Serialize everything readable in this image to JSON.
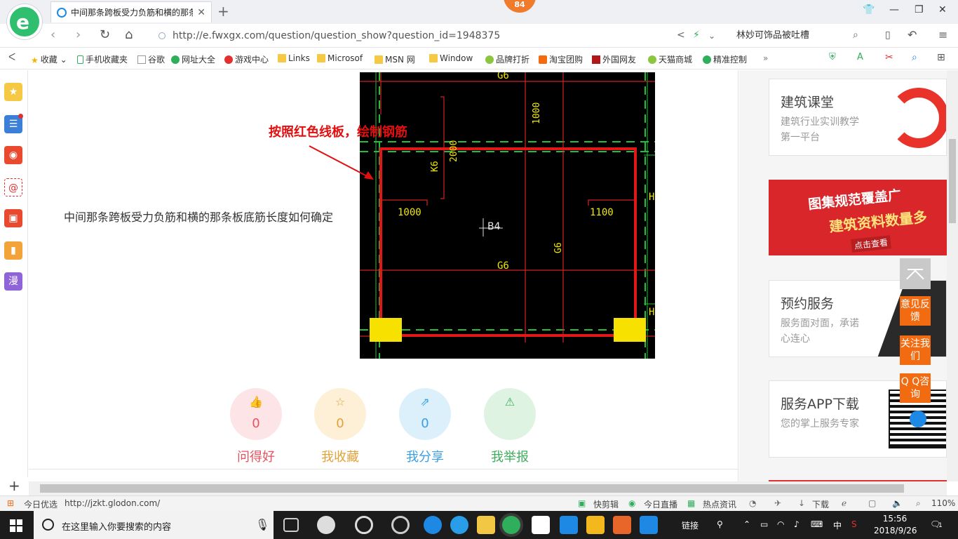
{
  "browser": {
    "tab_title": "中间那条跨板受力负筋和横的那条",
    "new_tab": "+",
    "notification_count": "84",
    "url": "http://e.fwxgx.com/question/question_show?question_id=1948375",
    "search_value": "林妙可饰品被吐槽"
  },
  "bookmarks": [
    {
      "label": "收藏"
    },
    {
      "label": "手机收藏夹"
    },
    {
      "label": "谷歌"
    },
    {
      "label": "网址大全"
    },
    {
      "label": "游戏中心"
    },
    {
      "label": "Links"
    },
    {
      "label": "Microsof"
    },
    {
      "label": "MSN 网"
    },
    {
      "label": "Window"
    },
    {
      "label": "品牌打折"
    },
    {
      "label": "淘宝团购"
    },
    {
      "label": "外国网友"
    },
    {
      "label": "天猫商城"
    },
    {
      "label": "精准控制"
    }
  ],
  "sidebar": {
    "manga_label": "漫"
  },
  "question": {
    "text": "中间那条跨板受力负筋和横的那条板底筋长度如何确定",
    "annotation": "按照红色线板，绘制钢筋"
  },
  "cad_labels": {
    "g6_top": "G6",
    "k6": "K6",
    "dim_2000": "2000",
    "dim_1000_v": "1000",
    "dim_1000_h": "1000",
    "dim_1100": "1100",
    "b4": "B4",
    "g6_mid": "G6",
    "g6_vert": "G6",
    "h1": "H",
    "h2": "H"
  },
  "actions": [
    {
      "label": "问得好",
      "count": "0",
      "color": "#e8525e",
      "bg": "#fde4e6",
      "icon": "thumbs-up-icon"
    },
    {
      "label": "我收藏",
      "count": "0",
      "color": "#e2a23a",
      "bg": "#fdf0d6",
      "icon": "star-icon"
    },
    {
      "label": "我分享",
      "count": "0",
      "color": "#3b9ee0",
      "bg": "#dcf0fc",
      "icon": "share-icon"
    },
    {
      "label": "我举报",
      "count": "0",
      "color": "#3fae5c",
      "bg": "#dff3e3",
      "icon": "warning-icon"
    }
  ],
  "right": {
    "card1": {
      "title": "建筑课堂",
      "sub": "建筑行业实训教学第一平台"
    },
    "promo": {
      "line1": "图集规范覆盖广",
      "line2": "建筑资料数量多",
      "cta": "点击查看"
    },
    "card2": {
      "title": "预约服务",
      "sub": "服务面对面，承诺心连心"
    },
    "card3": {
      "title": "服务APP下载",
      "sub": "您的掌上服务专家"
    }
  },
  "floating": {
    "feedback": "意见反馈",
    "follow": "关注我们",
    "qq": "Q Q咨询"
  },
  "statusbar": {
    "today": "今日优选",
    "link": "http://jzkt.glodon.com/",
    "clip": "快剪辑",
    "live": "今日直播",
    "news": "热点资讯",
    "download": "下载",
    "zoom": "110%"
  },
  "taskbar": {
    "search_placeholder": "在这里输入你要搜索的内容",
    "links": "链接",
    "ime": "中",
    "time": "15:56",
    "date": "2018/9/26",
    "notif": "1"
  }
}
